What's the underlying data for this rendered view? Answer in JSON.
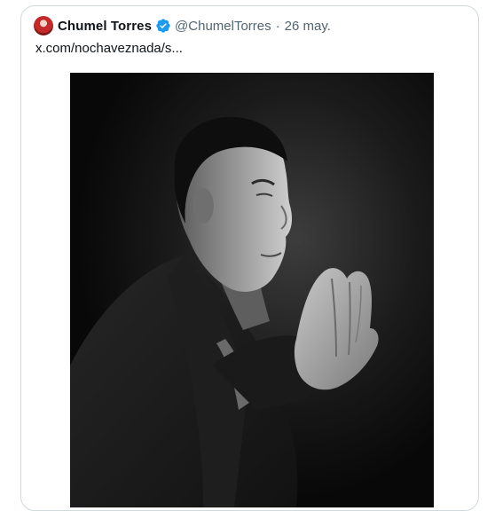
{
  "tweet": {
    "author_name": "Chumel Torres",
    "author_handle": "@ChumelTorres",
    "separator": "·",
    "date": "26 may.",
    "link_text": "x.com/nochaveznada/s..."
  },
  "icons": {
    "verified": "verified-badge-icon",
    "avatar": "avatar"
  },
  "colors": {
    "verified_blue": "#1d9bf0",
    "text_primary": "#0f1419",
    "text_secondary": "#536471",
    "border": "#cfd9de"
  },
  "media": {
    "kind": "black-and-white portrait photo"
  }
}
